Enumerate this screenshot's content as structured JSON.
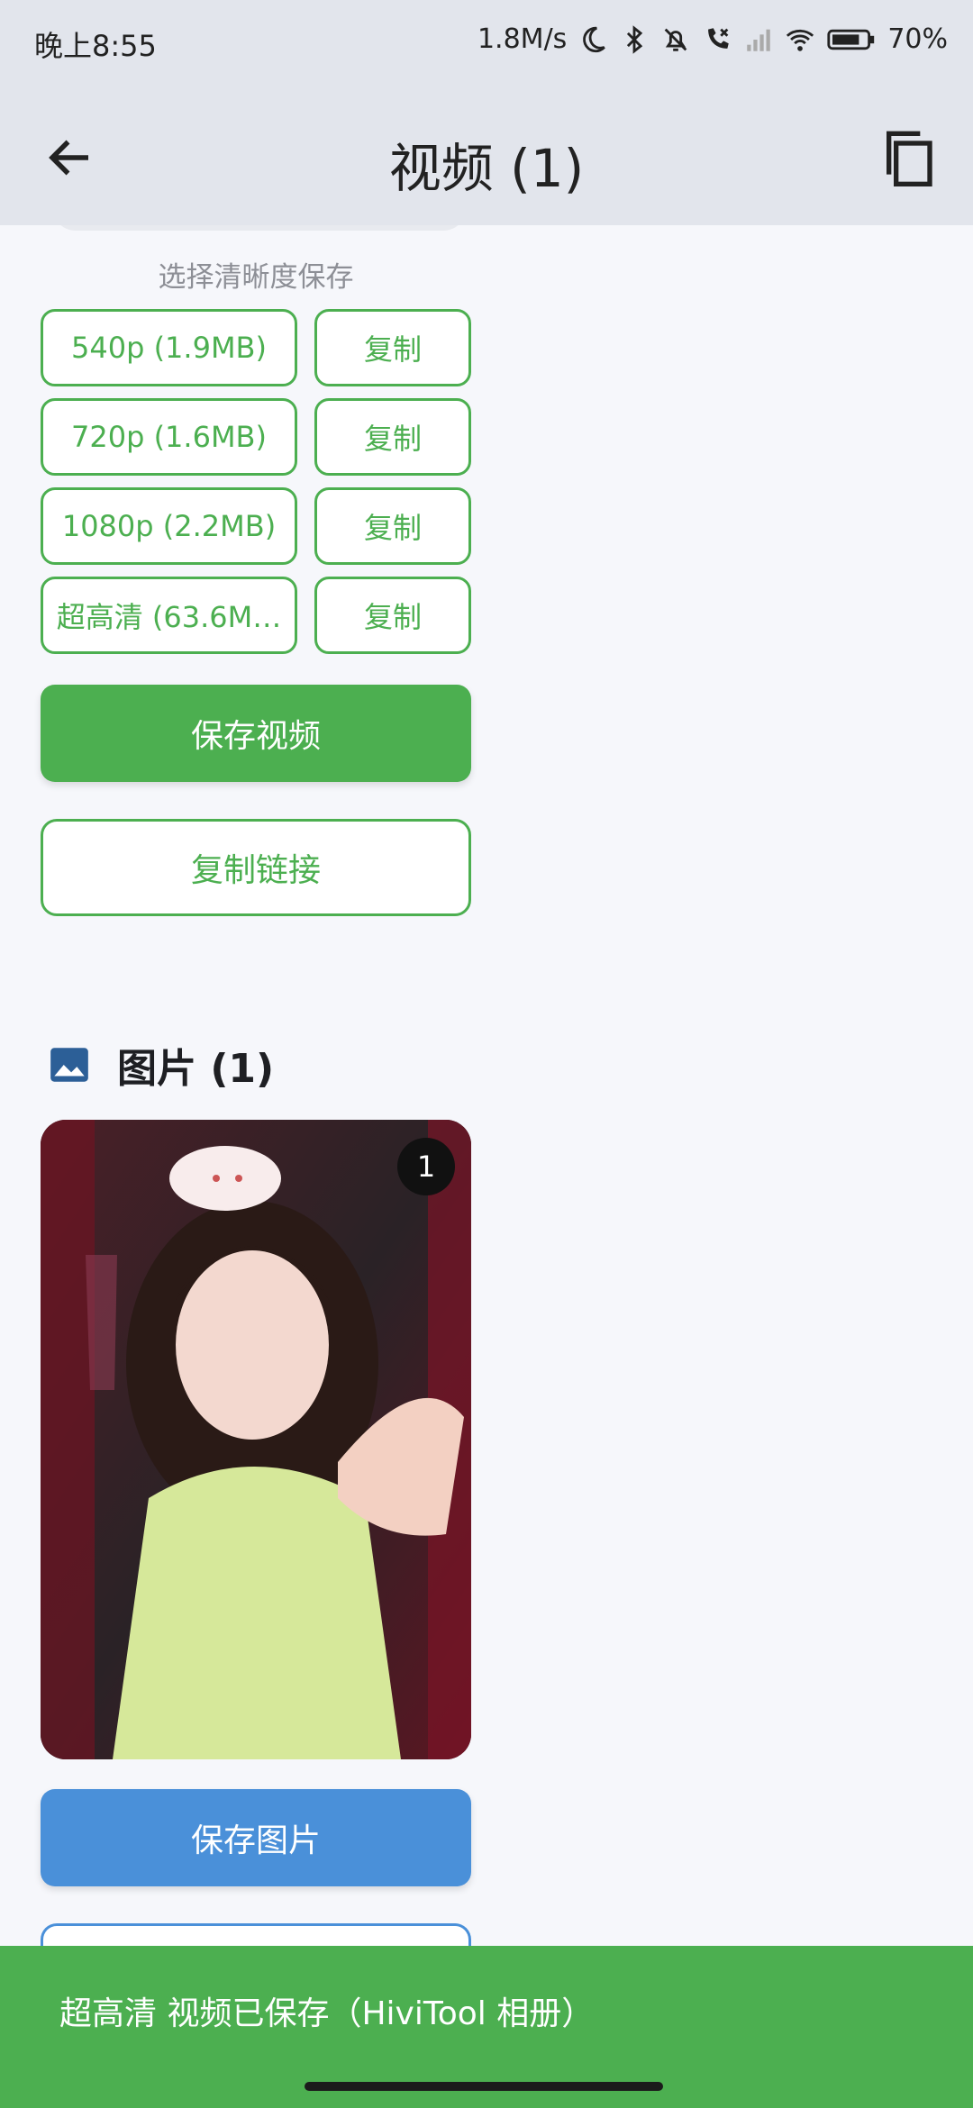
{
  "status_bar": {
    "time": "晚上8:55",
    "net_speed": "1.8M/s",
    "battery": "70%"
  },
  "app_bar": {
    "title": "视频 (1)"
  },
  "video_section": {
    "subtitle": "选择清晰度保存",
    "qualities": [
      {
        "label": "540p (1.9MB)",
        "copy": "复制"
      },
      {
        "label": "720p (1.6MB)",
        "copy": "复制"
      },
      {
        "label": "1080p (2.2MB)",
        "copy": "复制"
      },
      {
        "label": "超高清 (63.6M…",
        "copy": "复制"
      }
    ],
    "save_button": "保存视频",
    "copy_link_button": "复制链接"
  },
  "image_section": {
    "title": "图片 (1)",
    "badge": "1",
    "save_button": "保存图片"
  },
  "snackbar": {
    "message": "超高清 视频已保存（HiviTool 相册）"
  },
  "colors": {
    "accent_green": "#4caf50",
    "accent_blue": "#4a90d9",
    "bar_bg": "#e2e5ec"
  }
}
